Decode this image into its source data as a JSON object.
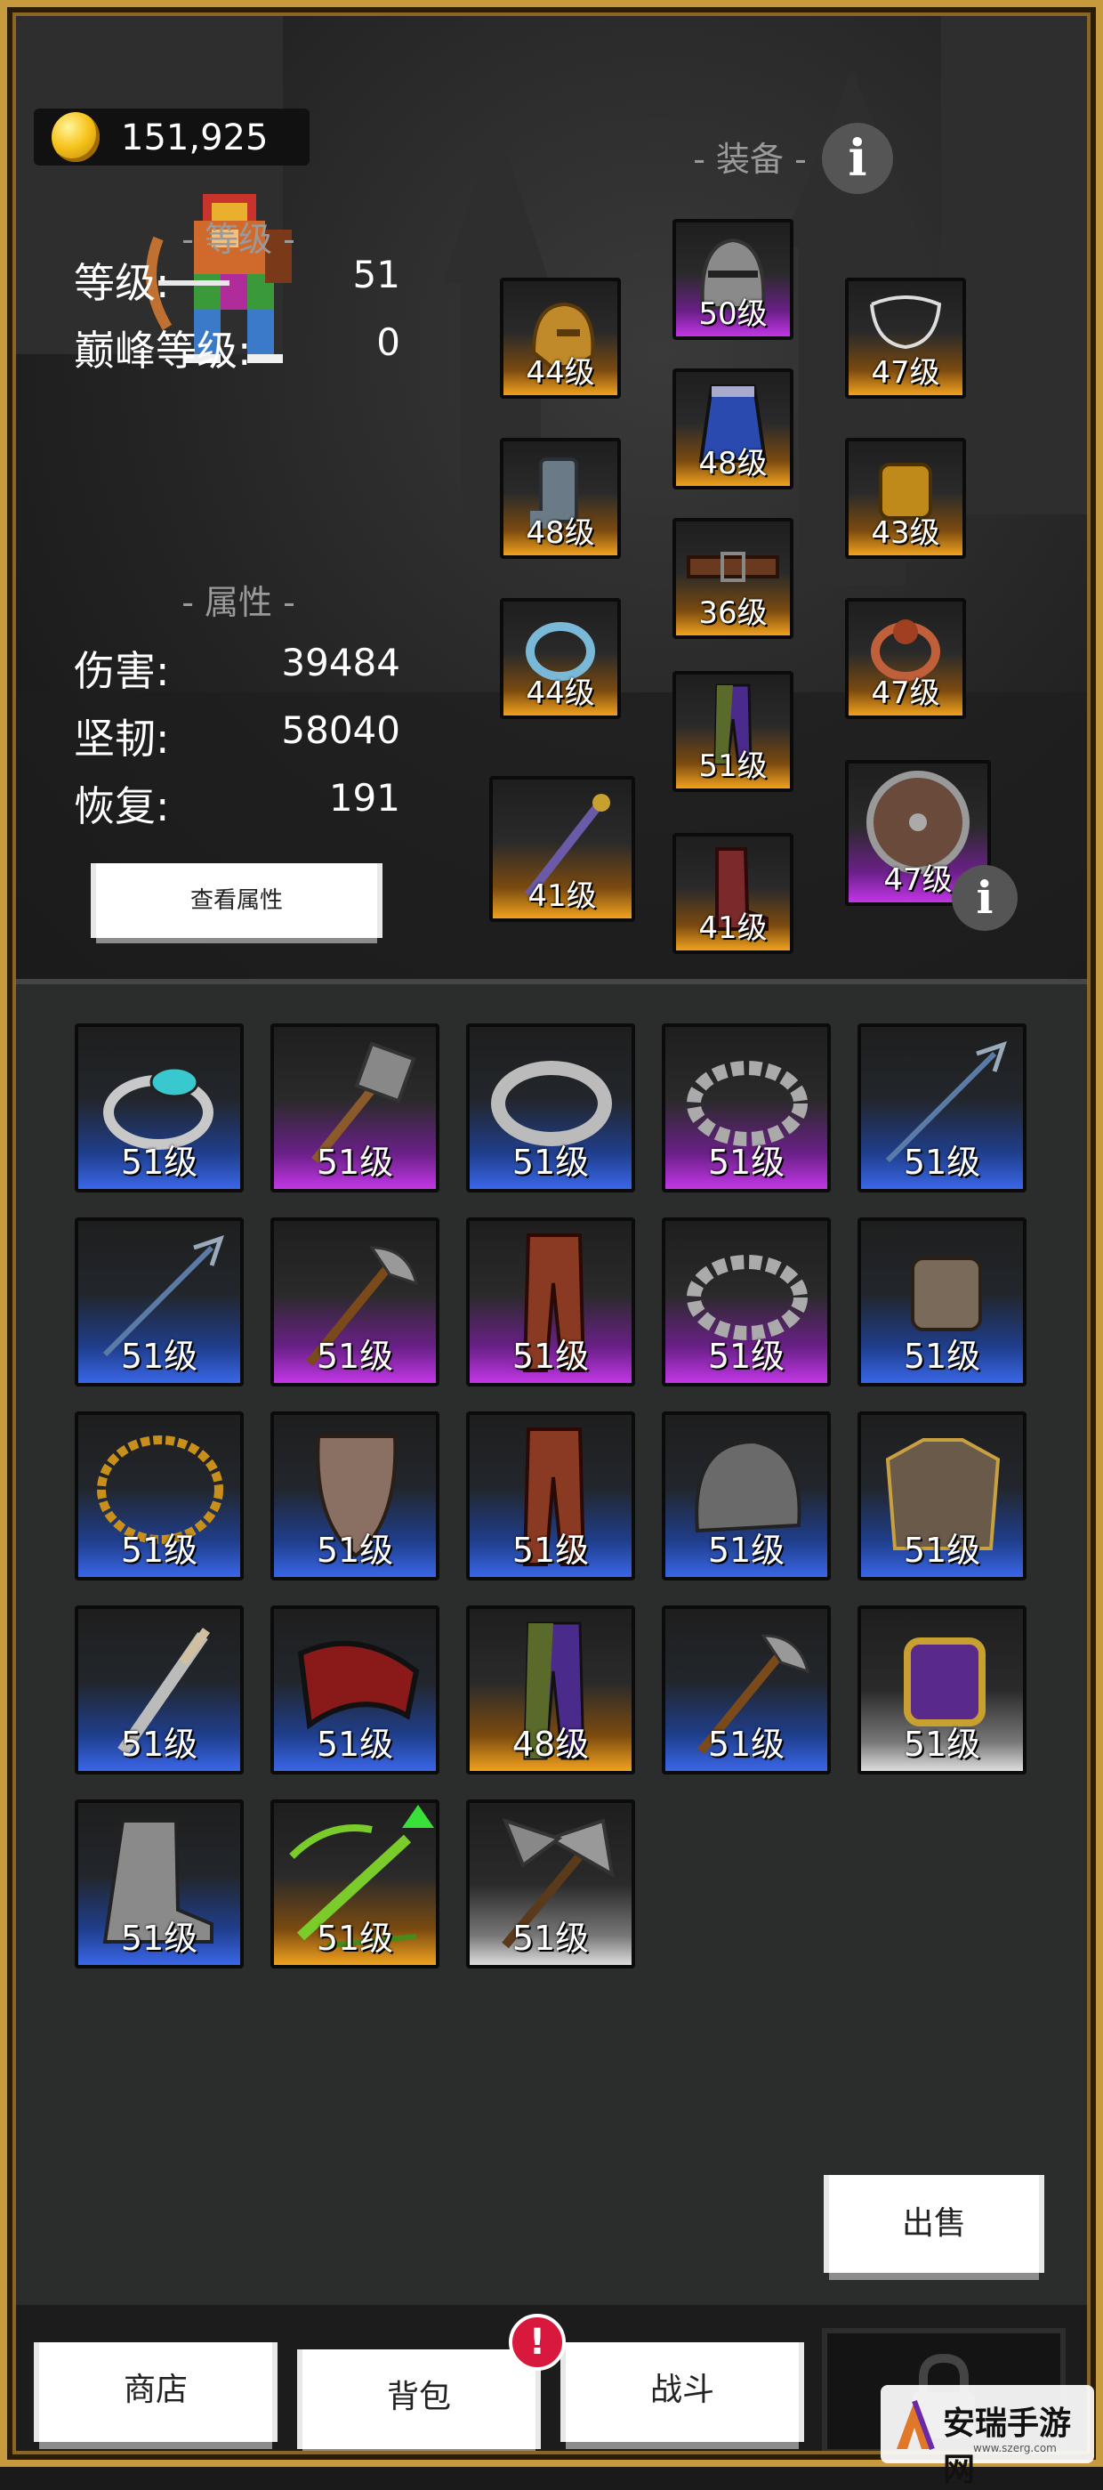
{
  "currency": {
    "gold": "151,925",
    "icon": "gold-coin-icon"
  },
  "headers": {
    "equipment": "- 装备 -",
    "level": "- 等级 -",
    "attributes": "- 属性 -",
    "info": "i"
  },
  "stats": {
    "level": {
      "label": "等级:",
      "value": "51"
    },
    "peak_level": {
      "label": "巅峰等级:",
      "value": "0"
    },
    "damage": {
      "label": "伤害:",
      "value": "39484"
    },
    "toughness": {
      "label": "坚韧:",
      "value": "58040"
    },
    "recovery": {
      "label": "恢复:",
      "value": "191"
    }
  },
  "buttons": {
    "view_attributes": "查看属性",
    "sell": "出售"
  },
  "equipped": [
    {
      "slot": "helmet-gold",
      "icon": "gold-helmet-icon",
      "level": "44级",
      "rarity": "orange"
    },
    {
      "slot": "helmet",
      "icon": "knight-helmet-icon",
      "level": "50级",
      "rarity": "purple"
    },
    {
      "slot": "necklace",
      "icon": "necklace-icon",
      "level": "47级",
      "rarity": "orange"
    },
    {
      "slot": "gloves",
      "icon": "gauntlet-icon",
      "level": "48级",
      "rarity": "orange"
    },
    {
      "slot": "cape",
      "icon": "cape-icon",
      "level": "48级",
      "rarity": "orange"
    },
    {
      "slot": "bracer",
      "icon": "bracer-icon",
      "level": "43级",
      "rarity": "orange"
    },
    {
      "slot": "ring1",
      "icon": "ring-icon",
      "level": "44级",
      "rarity": "orange"
    },
    {
      "slot": "belt",
      "icon": "belt-icon",
      "level": "36级",
      "rarity": "orange"
    },
    {
      "slot": "ring2",
      "icon": "ring-icon",
      "level": "47级",
      "rarity": "orange"
    },
    {
      "slot": "pants",
      "icon": "pants-icon",
      "level": "51级",
      "rarity": "orange"
    },
    {
      "slot": "weapon",
      "icon": "dagger-icon",
      "level": "41级",
      "rarity": "orange"
    },
    {
      "slot": "boots",
      "icon": "boots-icon",
      "level": "41级",
      "rarity": "orange"
    },
    {
      "slot": "shield",
      "icon": "shield-icon",
      "level": "47级",
      "rarity": "purple"
    }
  ],
  "inventory": [
    {
      "icon": "gem-ring-icon",
      "level": "51级",
      "rarity": "blue"
    },
    {
      "icon": "mace-icon",
      "level": "51级",
      "rarity": "purple"
    },
    {
      "icon": "band-ring-icon",
      "level": "51级",
      "rarity": "blue"
    },
    {
      "icon": "studded-ring-icon",
      "level": "51级",
      "rarity": "purple"
    },
    {
      "icon": "trident-icon",
      "level": "51级",
      "rarity": "blue"
    },
    {
      "icon": "trident-icon",
      "level": "51级",
      "rarity": "blue"
    },
    {
      "icon": "axe-icon",
      "level": "51级",
      "rarity": "purple"
    },
    {
      "icon": "leather-pants-icon",
      "level": "51级",
      "rarity": "purple"
    },
    {
      "icon": "studded-ring-icon",
      "level": "51级",
      "rarity": "purple"
    },
    {
      "icon": "bracer-icon",
      "level": "51级",
      "rarity": "blue"
    },
    {
      "icon": "chain-necklace-icon",
      "level": "51级",
      "rarity": "blue"
    },
    {
      "icon": "cloak-icon",
      "level": "51级",
      "rarity": "blue"
    },
    {
      "icon": "leather-pants-icon",
      "level": "51级",
      "rarity": "blue"
    },
    {
      "icon": "iron-helmet-icon",
      "level": "51级",
      "rarity": "blue"
    },
    {
      "icon": "chest-armor-icon",
      "level": "51级",
      "rarity": "blue"
    },
    {
      "icon": "knife-icon",
      "level": "51级",
      "rarity": "blue"
    },
    {
      "icon": "red-cape-icon",
      "level": "51级",
      "rarity": "blue"
    },
    {
      "icon": "pants-icon",
      "level": "48级",
      "rarity": "orange"
    },
    {
      "icon": "axe-icon",
      "level": "51级",
      "rarity": "blue"
    },
    {
      "icon": "purple-bracer-icon",
      "level": "51级",
      "rarity": "white"
    },
    {
      "icon": "iron-boots-icon",
      "level": "51级",
      "rarity": "blue"
    },
    {
      "icon": "crossbow-icon",
      "level": "51级",
      "rarity": "orange",
      "upgrade": true
    },
    {
      "icon": "battle-axe-icon",
      "level": "51级",
      "rarity": "white"
    }
  ],
  "nav": {
    "shop": "商店",
    "backpack": "背包",
    "battle": "战斗",
    "badge": "!"
  },
  "watermark": {
    "text": "安瑞手游网",
    "sub": "www.szerg.com"
  }
}
